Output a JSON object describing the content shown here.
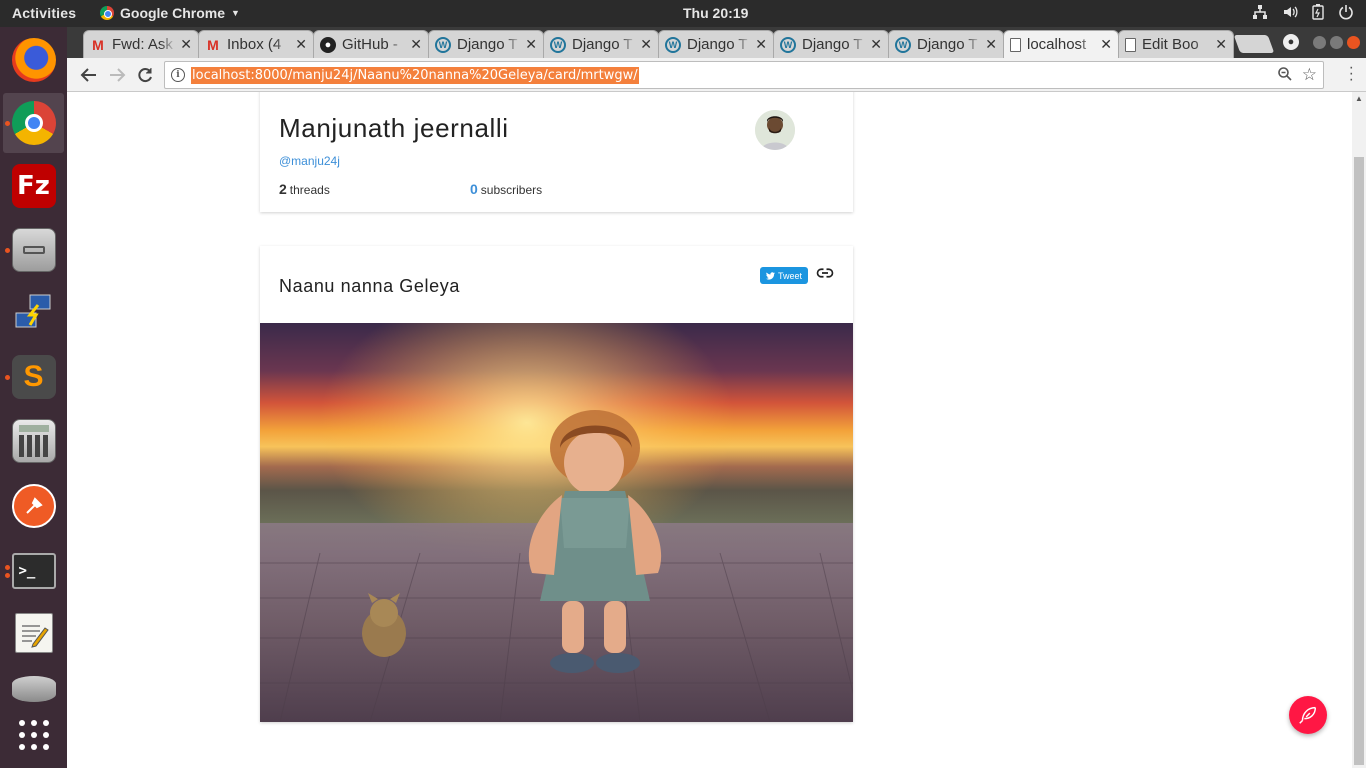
{
  "topbar": {
    "activities": "Activities",
    "app_name": "Google Chrome",
    "clock": "Thu 20:19"
  },
  "launcher": {
    "items": [
      "firefox",
      "chrome",
      "filezilla",
      "files",
      "remote-desktop",
      "sublime-text",
      "calculator",
      "postman",
      "terminal",
      "text-editor",
      "disk",
      "app-grid"
    ]
  },
  "browser": {
    "tabs": [
      {
        "title": "Fwd: Ask",
        "icon": "gmail-icon"
      },
      {
        "title": "Inbox (4",
        "icon": "gmail-icon"
      },
      {
        "title": "GitHub -",
        "icon": "github-icon"
      },
      {
        "title": "Django T",
        "icon": "wordpress-icon"
      },
      {
        "title": "Django T",
        "icon": "wordpress-icon"
      },
      {
        "title": "Django T",
        "icon": "wordpress-icon"
      },
      {
        "title": "Django T",
        "icon": "wordpress-icon"
      },
      {
        "title": "Django T",
        "icon": "wordpress-icon"
      },
      {
        "title": "localhost",
        "icon": "document-icon",
        "active": true
      },
      {
        "title": "Edit Boo",
        "icon": "document-icon"
      }
    ],
    "url": "localhost:8000/manju24j/Naanu%20nanna%20Geleya/card/mrtwgw/"
  },
  "profile": {
    "name": "Manjunath jeernalli",
    "handle": "@manju24j",
    "threads_count": "2",
    "threads_label": "threads",
    "subscribers_count": "0",
    "subscribers_label": "subscribers"
  },
  "post": {
    "title": "Naanu nanna Geleya",
    "tweet_label": "Tweet"
  },
  "colors": {
    "accent": "#ff1744",
    "link": "#3d8fd8",
    "tweet": "#1b95e0",
    "url_highlight": "#f4803c",
    "launcher_bg": "#3c2b36"
  }
}
